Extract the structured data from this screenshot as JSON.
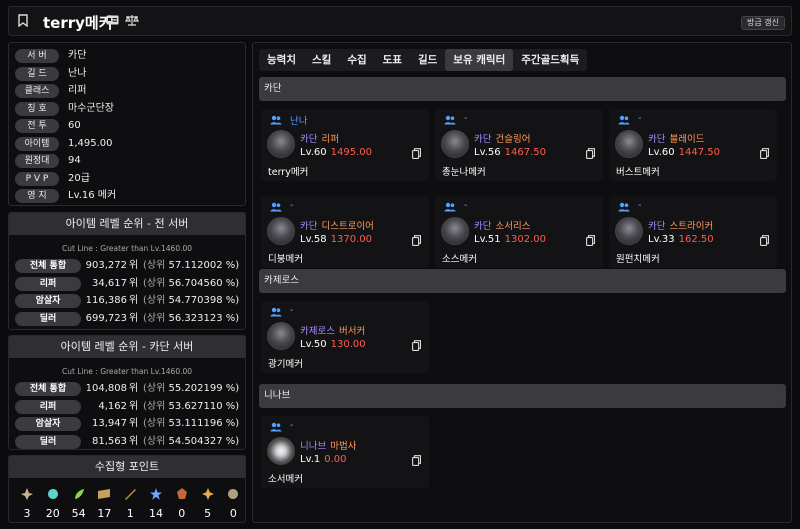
{
  "header": {
    "title": "terry메커",
    "refresh_label": "방금 갱신"
  },
  "profile": {
    "rows": [
      {
        "label": "서 버",
        "value": "카단"
      },
      {
        "label": "길 드",
        "value": "난나"
      },
      {
        "label": "클래스",
        "value": "리퍼"
      },
      {
        "label": "칭 호",
        "value": "마수군단장"
      },
      {
        "label": "전 투",
        "value": "60"
      },
      {
        "label": "아이템",
        "value": "1,495.00"
      },
      {
        "label": "원정대",
        "value": "94"
      },
      {
        "label": "P V P",
        "value": "20급"
      },
      {
        "label": "영 지",
        "value": "Lv.16 메커"
      }
    ]
  },
  "rank_all": {
    "title": "아이템 레벨 순위 - 전 서버",
    "cutline": "Cut Line : Greater than Lv.1460.00",
    "rows": [
      {
        "label": "전체 통합",
        "rank": "903,272",
        "wi": "위",
        "sang": "(상위",
        "pct": "57.112002 %)"
      },
      {
        "label": "리퍼",
        "rank": "34,617",
        "wi": "위",
        "sang": "(상위",
        "pct": "56.704560 %)"
      },
      {
        "label": "암살자",
        "rank": "116,386",
        "wi": "위",
        "sang": "(상위",
        "pct": "54.770398 %)"
      },
      {
        "label": "딜러",
        "rank": "699,723",
        "wi": "위",
        "sang": "(상위",
        "pct": "56.323123 %)"
      }
    ]
  },
  "rank_server": {
    "title": "아이템 레벨 순위 - 카단 서버",
    "cutline": "Cut Line : Greater than Lv.1460.00",
    "rows": [
      {
        "label": "전체 통합",
        "rank": "104,808",
        "wi": "위",
        "sang": "(상위",
        "pct": "55.202199 %)"
      },
      {
        "label": "리퍼",
        "rank": "4,162",
        "wi": "위",
        "sang": "(상위",
        "pct": "53.627110 %)"
      },
      {
        "label": "암살자",
        "rank": "13,947",
        "wi": "위",
        "sang": "(상위",
        "pct": "53.111196 %)"
      },
      {
        "label": "딜러",
        "rank": "81,563",
        "wi": "위",
        "sang": "(상위",
        "pct": "54.504327 %)"
      }
    ]
  },
  "collect": {
    "title": "수집형 포인트",
    "items": [
      {
        "icon": "mokoko-seed-icon",
        "value": "3",
        "color": "#c8b68a"
      },
      {
        "icon": "island-heart-icon",
        "value": "20",
        "color": "#5fd3c9"
      },
      {
        "icon": "giant-heart-icon",
        "value": "54",
        "color": "#8fd14f"
      },
      {
        "icon": "art-map-icon",
        "value": "17",
        "color": "#c9a25a"
      },
      {
        "icon": "voyage-icon",
        "value": "1",
        "color": "#c98a3a"
      },
      {
        "icon": "star-leaf-icon",
        "value": "14",
        "color": "#6fa8ff"
      },
      {
        "icon": "world-tree-icon",
        "value": "0",
        "color": "#c46a3a"
      },
      {
        "icon": "orpheus-star-icon",
        "value": "5",
        "color": "#e0b040"
      },
      {
        "icon": "ignea-token-icon",
        "value": "0",
        "color": "#b0a080"
      }
    ]
  },
  "tabs": [
    {
      "label": "능력치",
      "active": false
    },
    {
      "label": "스킬",
      "active": false
    },
    {
      "label": "수집",
      "active": false
    },
    {
      "label": "도표",
      "active": false
    },
    {
      "label": "길드",
      "active": false
    },
    {
      "label": "보유 캐릭터",
      "active": true
    },
    {
      "label": "주간골드획득",
      "active": false
    }
  ],
  "servers": [
    {
      "name": "카단",
      "characters": [
        {
          "guild": "난나",
          "server": "카단",
          "class": "리퍼",
          "level": "Lv.60",
          "item_level": "1495.00",
          "name": "terry메커",
          "elem": false
        },
        {
          "guild": "-",
          "server": "카단",
          "class": "건슬링어",
          "level": "Lv.56",
          "item_level": "1467.50",
          "name": "총눈나메커",
          "elem": false
        },
        {
          "guild": "-",
          "server": "카단",
          "class": "블레이드",
          "level": "Lv.60",
          "item_level": "1447.50",
          "name": "버스트메커",
          "elem": false
        },
        {
          "guild": "-",
          "server": "카단",
          "class": "디스트로이어",
          "level": "Lv.58",
          "item_level": "1370.00",
          "name": "디붕메커",
          "elem": false
        },
        {
          "guild": "-",
          "server": "카단",
          "class": "소서리스",
          "level": "Lv.51",
          "item_level": "1302.00",
          "name": "소스메커",
          "elem": false
        },
        {
          "guild": "-",
          "server": "카단",
          "class": "스트라이커",
          "level": "Lv.33",
          "item_level": "162.50",
          "name": "원펀치메커",
          "elem": false
        }
      ]
    },
    {
      "name": "카제로스",
      "characters": [
        {
          "guild": "-",
          "server": "카제로스",
          "class": "버서커",
          "level": "Lv.50",
          "item_level": "130.00",
          "name": "광기메커",
          "elem": false
        }
      ]
    },
    {
      "name": "니나브",
      "characters": [
        {
          "guild": "-",
          "server": "니나브",
          "class": "마법사",
          "level": "Lv.1",
          "item_level": "0.00",
          "name": "소서메커",
          "elem": true
        }
      ]
    }
  ]
}
